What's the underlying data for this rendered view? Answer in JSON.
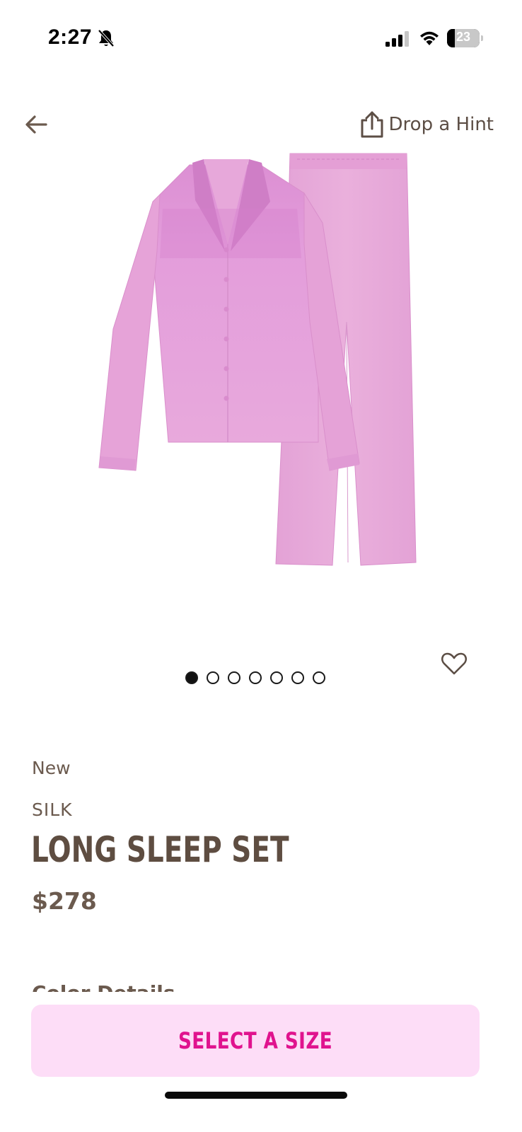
{
  "status_bar": {
    "time": "2:27",
    "battery_percent": "23",
    "battery_level": 0.23,
    "icons": [
      "bell-slash-icon",
      "cellular-signal-icon",
      "wifi-icon",
      "battery-icon"
    ]
  },
  "header": {
    "back_icon": "arrow-left-icon",
    "share_icon": "share-icon",
    "drop_hint_label": "Drop a Hint"
  },
  "carousel": {
    "total_images": 7,
    "active_index": 0,
    "favorite_icon": "heart-outline-icon"
  },
  "product": {
    "badge": "New",
    "collection": "SILK",
    "title": "LONG SLEEP SET",
    "price": "$278",
    "section_peek": "Color Details"
  },
  "cta": {
    "label": "SELECT A SIZE"
  },
  "colors": {
    "text_brown": "#6b5a4e",
    "title_brown": "#5e4d41",
    "cta_background": "#fdddf7",
    "cta_text": "#e0138e",
    "product_pink": "#e6a3d6"
  }
}
